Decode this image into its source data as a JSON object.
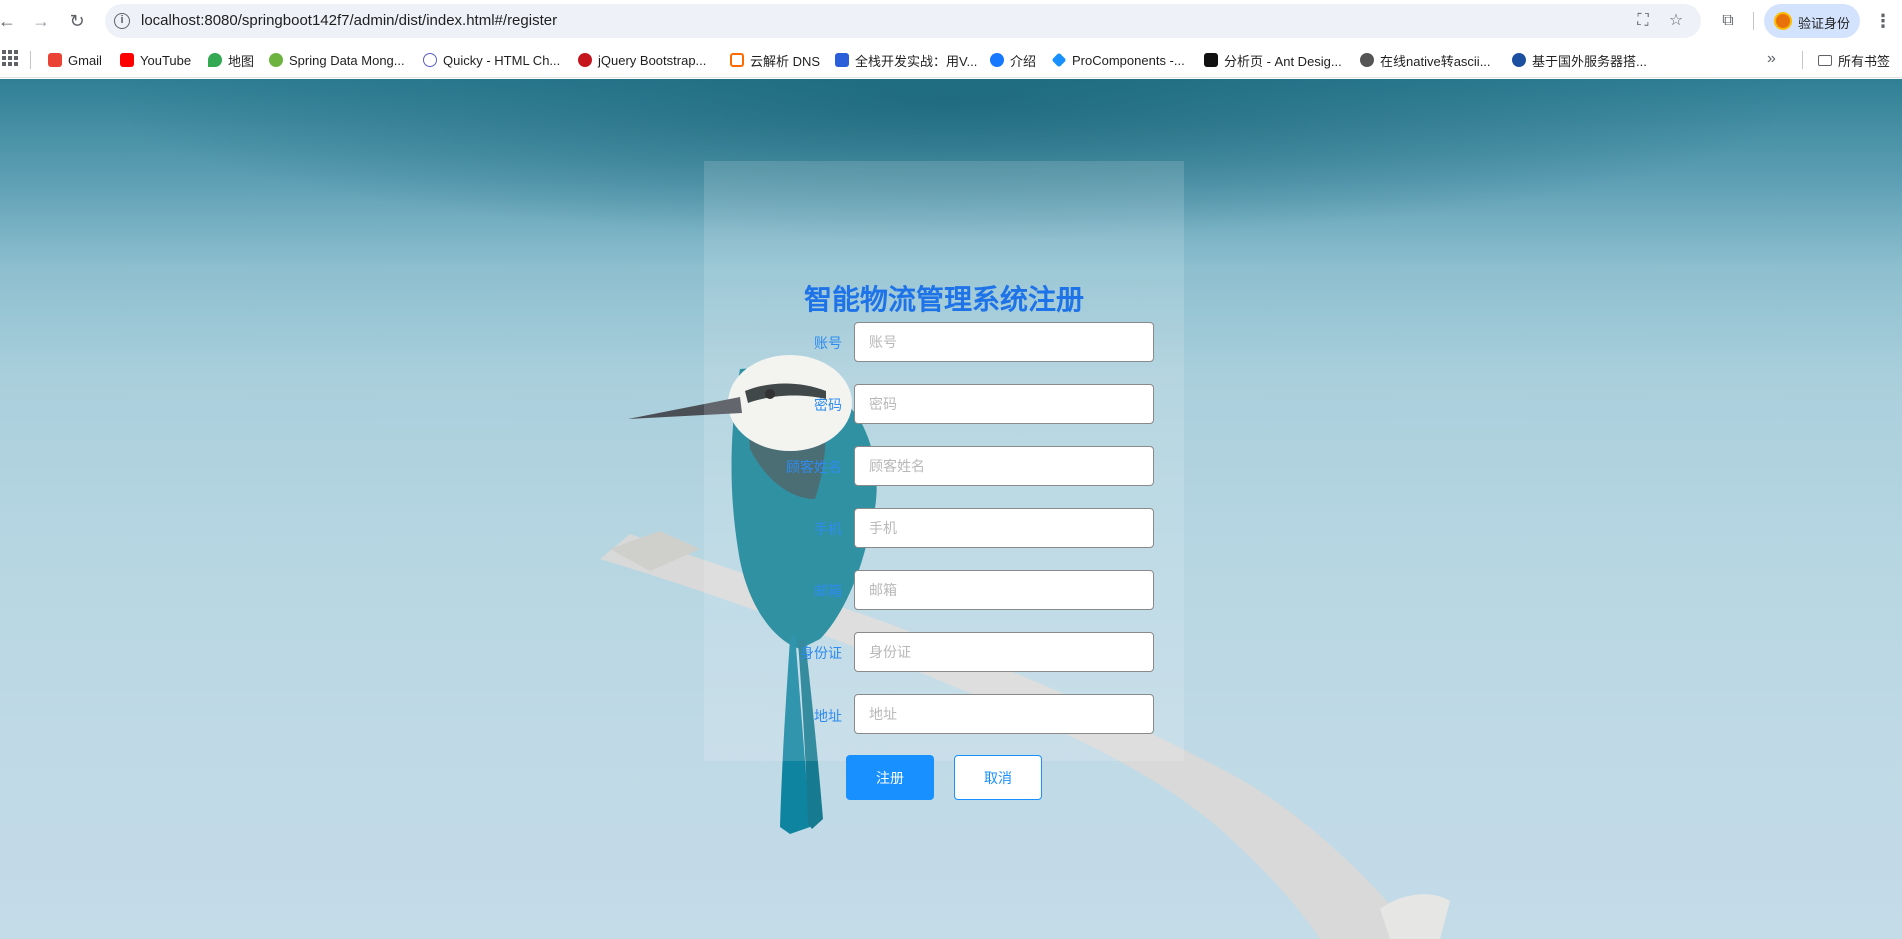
{
  "browser": {
    "url": "localhost:8080/springboot142f7/admin/dist/index.html#/register",
    "profile_label": "验证身份",
    "icons": [
      "back-icon",
      "forward-icon",
      "reload-icon",
      "site-info-icon",
      "translate-icon",
      "star-icon",
      "extensions-icon",
      "menu-icon"
    ]
  },
  "bookmarks": {
    "items": [
      {
        "label": "Gmail",
        "color": "#ea4335"
      },
      {
        "label": "YouTube",
        "color": "#ff0000"
      },
      {
        "label": "地图",
        "color": "#34a853"
      },
      {
        "label": "Spring Data Mong...",
        "color": "#6db33f"
      },
      {
        "label": "Quicky - HTML Ch...",
        "color": "#5b5fc7"
      },
      {
        "label": "jQuery Bootstrap...",
        "color": "#c4161c"
      },
      {
        "label": "云解析 DNS",
        "color": "#ff6a00"
      },
      {
        "label": "全栈开发实战：用V...",
        "color": "#2b5fd9"
      },
      {
        "label": "介绍",
        "color": "#1677ff"
      },
      {
        "label": "ProComponents -...",
        "color": "#1890ff"
      },
      {
        "label": "分析页 - Ant Desig...",
        "color": "#111111"
      },
      {
        "label": "在线native转ascii...",
        "color": "#555555"
      },
      {
        "label": "基于国外服务器搭...",
        "color": "#1d4fa0"
      }
    ],
    "all_bookmarks": "所有书签"
  },
  "form": {
    "title": "智能物流管理系统注册",
    "fields": [
      {
        "label": "账号",
        "placeholder": "账号",
        "value": ""
      },
      {
        "label": "密码",
        "placeholder": "密码",
        "value": ""
      },
      {
        "label": "顾客姓名",
        "placeholder": "顾客姓名",
        "value": ""
      },
      {
        "label": "手机",
        "placeholder": "手机",
        "value": ""
      },
      {
        "label": "邮箱",
        "placeholder": "邮箱",
        "value": ""
      },
      {
        "label": "身份证",
        "placeholder": "身份证",
        "value": ""
      },
      {
        "label": "地址",
        "placeholder": "地址",
        "value": ""
      }
    ],
    "register_label": "注册",
    "cancel_label": "取消"
  },
  "colors": {
    "accent": "#1890ff",
    "title": "#1e73e8",
    "label": "#2d8cf0"
  }
}
